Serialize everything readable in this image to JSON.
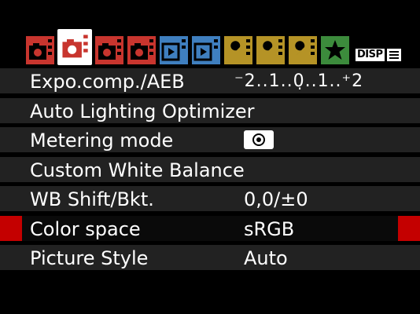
{
  "tabs": [
    {
      "name": "shooting-menu-1",
      "color": "#c8352e",
      "icon": "camera-icon",
      "number": "1",
      "active": false
    },
    {
      "name": "shooting-menu-2",
      "color": "#c8352e",
      "icon": "camera-icon",
      "number": "2",
      "active": true
    },
    {
      "name": "shooting-menu-3",
      "color": "#c8352e",
      "icon": "camera-icon",
      "number": "3",
      "active": false
    },
    {
      "name": "shooting-menu-4",
      "color": "#c8352e",
      "icon": "camera-icon",
      "number": "4",
      "active": false
    },
    {
      "name": "playback-menu-1",
      "color": "#3f7fbf",
      "icon": "playback-icon",
      "number": "1",
      "active": false
    },
    {
      "name": "playback-menu-2",
      "color": "#3f7fbf",
      "icon": "playback-icon",
      "number": "2",
      "active": false
    },
    {
      "name": "setup-menu-1",
      "color": "#b59326",
      "icon": "wrench-icon",
      "number": "1",
      "active": false
    },
    {
      "name": "setup-menu-2",
      "color": "#b59326",
      "icon": "wrench-icon",
      "number": "2",
      "active": false
    },
    {
      "name": "setup-menu-3",
      "color": "#b59326",
      "icon": "wrench-icon",
      "number": "3",
      "active": false
    },
    {
      "name": "my-menu",
      "color": "#3c8b3c",
      "icon": "star-icon",
      "number": "",
      "active": false
    }
  ],
  "disp": {
    "label": "DISP",
    "icon": "list-icon"
  },
  "menu": [
    {
      "label": "Expo.comp./AEB",
      "value": "⁻2..1..0̣..1..⁺2",
      "type": "scale",
      "selected": false
    },
    {
      "label": "Auto Lighting Optimizer",
      "value": "",
      "type": "none",
      "selected": false
    },
    {
      "label": "Metering mode",
      "value": "",
      "type": "icon",
      "icon": "evaluative-metering-icon",
      "selected": false
    },
    {
      "label": "Custom White Balance",
      "value": "",
      "type": "none",
      "selected": false
    },
    {
      "label": "WB Shift/Bkt.",
      "value": "0,0/±0",
      "type": "text",
      "selected": false
    },
    {
      "label": "Color space",
      "value": "sRGB",
      "type": "text",
      "selected": true
    },
    {
      "label": "Picture Style",
      "value": "Auto",
      "type": "text",
      "selected": false
    }
  ]
}
